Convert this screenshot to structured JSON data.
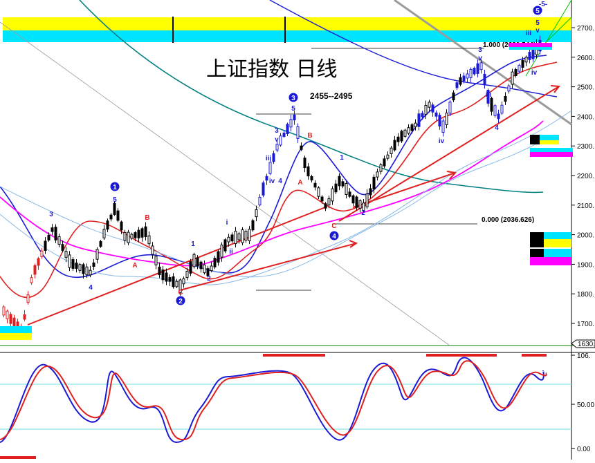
{
  "chart_data": {
    "type": "candlestick",
    "title": "上证指数 日线",
    "annotation_range": "2455--2495",
    "price_axis": {
      "ylim": [
        1630,
        2750
      ],
      "ticks": [
        "2700.",
        "2600.",
        "2500.",
        "2400.",
        "2300.",
        "2200.",
        "2100.",
        "2000.",
        "1900.",
        "1800.",
        "1700."
      ]
    },
    "current_price_label": "1630.",
    "fib_labels": {
      "top": "1.000 (2630.544)",
      "bottom": "0.000 (2036.626)"
    },
    "osc_axis": {
      "ylim": [
        0,
        106
      ],
      "ticks": [
        "106.",
        "50.00",
        "0.00"
      ]
    },
    "wave_labels": [
      {
        "t": "3",
        "x": 74,
        "y": 313,
        "c": "#1a1ad6"
      },
      {
        "t": "4",
        "x": 131,
        "y": 419,
        "c": "#1a1ad6"
      },
      {
        "t": "1",
        "x": 166,
        "y": 274,
        "c": "#1a1ad6",
        "circle": true
      },
      {
        "t": "5",
        "x": 166,
        "y": 292,
        "c": "#1a1ad6"
      },
      {
        "t": "B",
        "x": 213,
        "y": 318,
        "c": "#e02020"
      },
      {
        "t": "A",
        "x": 195,
        "y": 387,
        "c": "#e02020"
      },
      {
        "t": "1",
        "x": 279,
        "y": 356,
        "c": "#1a1ad6"
      },
      {
        "t": "C",
        "x": 261,
        "y": 426,
        "c": "#e02020"
      },
      {
        "t": "2",
        "x": 261,
        "y": 439,
        "c": "#1a1ad6",
        "circle": true
      },
      {
        "t": "2",
        "x": 302,
        "y": 406,
        "c": "#1a1ad6"
      },
      {
        "t": "i",
        "x": 328,
        "y": 325,
        "c": "#1a1ad6"
      },
      {
        "t": "ii",
        "x": 334,
        "y": 367,
        "c": "#1a1ad6"
      },
      {
        "t": "3",
        "x": 424,
        "y": 145,
        "c": "#1a1ad6",
        "circle": true
      },
      {
        "t": "5",
        "x": 424,
        "y": 160,
        "c": "#1a1ad6"
      },
      {
        "t": "3",
        "x": 400,
        "y": 192,
        "c": "#1a1ad6"
      },
      {
        "t": "v",
        "x": 400,
        "y": 205,
        "c": "#1a1ad6"
      },
      {
        "t": "iii",
        "x": 388,
        "y": 232,
        "c": "#1a1ad6"
      },
      {
        "t": "iv",
        "x": 393,
        "y": 265,
        "c": "#1a1ad6"
      },
      {
        "t": "4",
        "x": 405,
        "y": 265,
        "c": "#1a1ad6"
      },
      {
        "t": "B",
        "x": 448,
        "y": 199,
        "c": "#e02020"
      },
      {
        "t": "A",
        "x": 434,
        "y": 267,
        "c": "#e02020"
      },
      {
        "t": "1",
        "x": 494,
        "y": 231,
        "c": "#1a1ad6"
      },
      {
        "t": "C",
        "x": 483,
        "y": 330,
        "c": "#e02020"
      },
      {
        "t": "4",
        "x": 483,
        "y": 345,
        "c": "#1a1ad6",
        "circle": true
      },
      {
        "t": "2",
        "x": 525,
        "y": 311,
        "c": "#1a1ad6"
      },
      {
        "t": "iv",
        "x": 638,
        "y": 207,
        "c": "#1a1ad6"
      },
      {
        "t": "3",
        "x": 694,
        "y": 75,
        "c": "#1a1ad6"
      },
      {
        "t": "v",
        "x": 694,
        "y": 87,
        "c": "#1a1ad6"
      },
      {
        "t": "iii",
        "x": 706,
        "y": 140,
        "c": "#1a1ad6"
      },
      {
        "t": "4",
        "x": 718,
        "y": 188,
        "c": "#1a1ad6"
      },
      {
        "t": "iii",
        "x": 764,
        "y": 51,
        "c": "#1a1ad6"
      },
      {
        "t": "iv",
        "x": 772,
        "y": 108,
        "c": "#1a1ad6"
      },
      {
        "t": "5",
        "x": 777,
        "y": 19,
        "c": "#1a1ad6",
        "circle": true
      },
      {
        "t": "5",
        "x": 777,
        "y": 36,
        "c": "#1a1ad6"
      },
      {
        "t": "v",
        "x": 777,
        "y": 47,
        "c": "#1a1ad6"
      },
      {
        "t": "-5-",
        "x": 785,
        "y": 9,
        "c": "#1a1ad6"
      }
    ],
    "series": [
      {
        "name": "",
        "color": "#1a1ad6"
      },
      {
        "name": "",
        "color": "#e02020"
      },
      {
        "name": "",
        "color": "#ff00ff"
      },
      {
        "name": "",
        "color": "#008080"
      }
    ]
  }
}
